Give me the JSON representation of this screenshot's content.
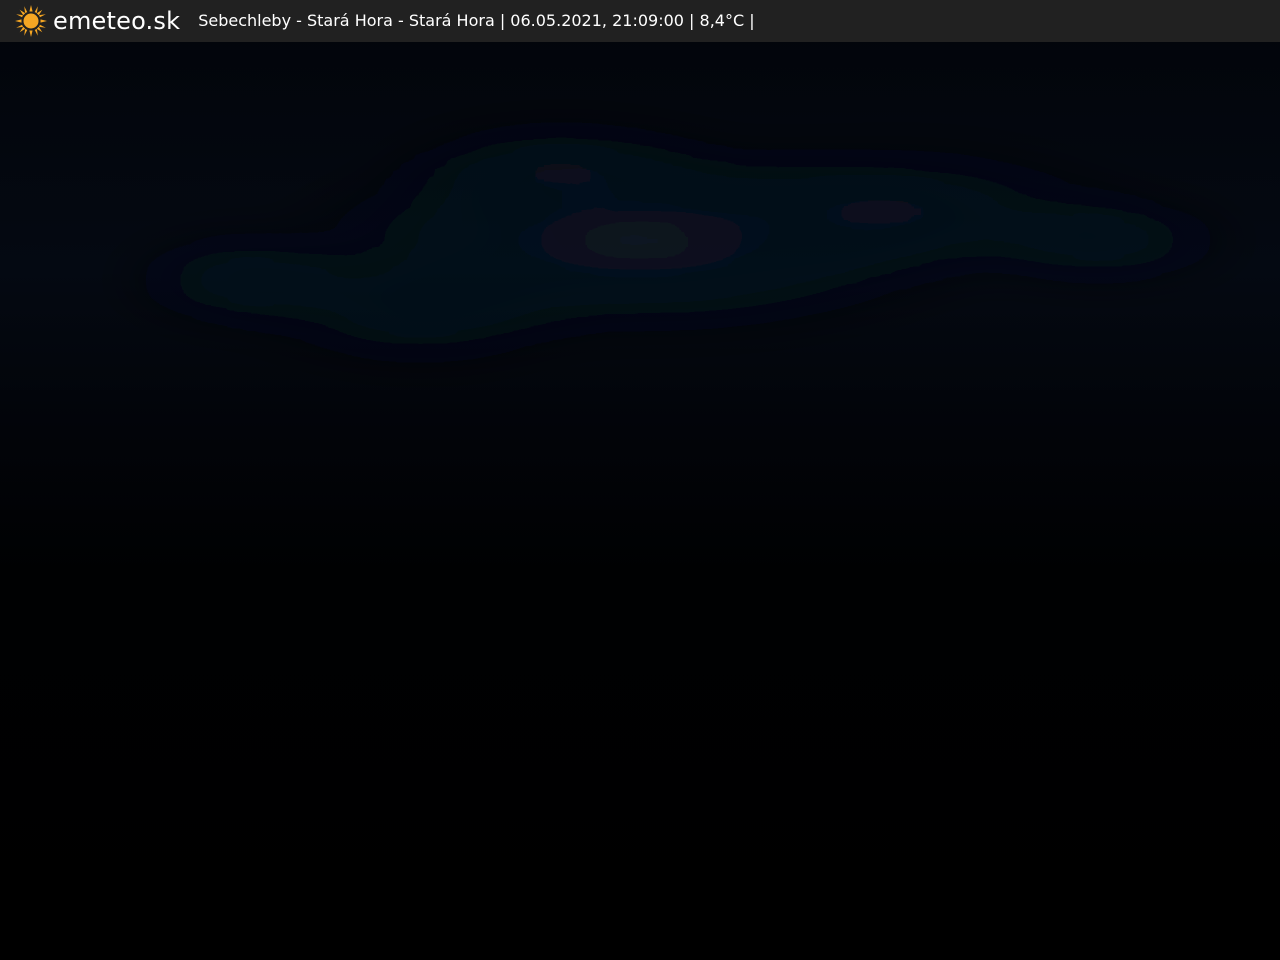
{
  "header": {
    "brand": "emeteo.sk",
    "logo_icon": "sun-icon",
    "caption": "Sebechleby - Stará Hora - Stará Hora | 06.05.2021, 21:09:00 | 8,4°C |"
  },
  "colors": {
    "bar_background": "#212121",
    "text": "#ffffff",
    "sun": "#f5a623"
  }
}
